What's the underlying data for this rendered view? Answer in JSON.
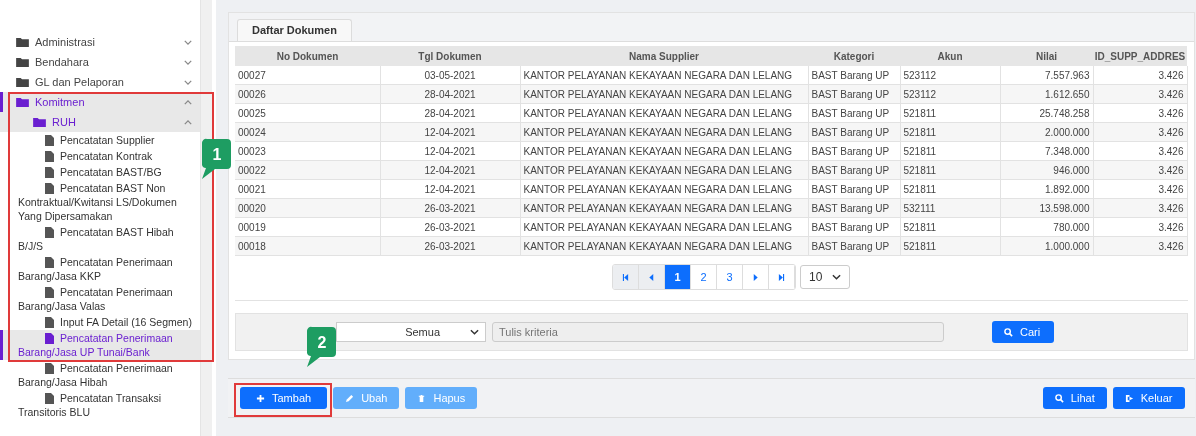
{
  "sidebar": {
    "items": [
      {
        "label": "Administrasi",
        "expanded": false,
        "active": false
      },
      {
        "label": "Bendahara",
        "expanded": false,
        "active": false
      },
      {
        "label": "GL dan Pelaporan",
        "expanded": false,
        "active": false
      },
      {
        "label": "Komitmen",
        "expanded": true,
        "active": true,
        "children": [
          {
            "label": "RUH",
            "expanded": true,
            "active": true,
            "children": [
              {
                "label": "Pencatatan Supplier",
                "selected": false
              },
              {
                "label": "Pencatatan Kontrak",
                "selected": false
              },
              {
                "label": "Pencatatan BAST/BG",
                "selected": false
              },
              {
                "label": "Pencatatan BAST Non Kontraktual/Kwitansi LS/Dokumen Yang Dipersamakan",
                "selected": false
              },
              {
                "label": "Pencatatan BAST Hibah B/J/S",
                "selected": false
              },
              {
                "label": "Pencatatan Penerimaan Barang/Jasa KKP",
                "selected": false
              },
              {
                "label": "Pencatatan Penerimaan Barang/Jasa Valas",
                "selected": false
              },
              {
                "label": "Input FA Detail (16 Segmen)",
                "selected": false
              },
              {
                "label": "Pencatatan Penerimaan Barang/Jasa UP Tunai/Bank",
                "selected": true
              },
              {
                "label": "Pencatatan Penerimaan Barang/Jasa Hibah",
                "selected": false
              },
              {
                "label": "Pencatatan Transaksi Transitoris BLU",
                "selected": false
              }
            ]
          }
        ]
      }
    ]
  },
  "panel": {
    "tab": "Daftar Dokumen",
    "table": {
      "columns": [
        "No Dokumen",
        "Tgl Dokumen",
        "Nama Supplier",
        "Kategori",
        "Akun",
        "Nilai",
        "ID_SUPP_ADDRES"
      ],
      "rows": [
        [
          "00027",
          "03-05-2021",
          "KANTOR PELAYANAN KEKAYAAN NEGARA DAN LELANG",
          "BAST Barang UP",
          "523112",
          "7.557.963",
          "3.426"
        ],
        [
          "00026",
          "28-04-2021",
          "KANTOR PELAYANAN KEKAYAAN NEGARA DAN LELANG",
          "BAST Barang UP",
          "523112",
          "1.612.650",
          "3.426"
        ],
        [
          "00025",
          "28-04-2021",
          "KANTOR PELAYANAN KEKAYAAN NEGARA DAN LELANG",
          "BAST Barang UP",
          "521811",
          "25.748.258",
          "3.426"
        ],
        [
          "00024",
          "12-04-2021",
          "KANTOR PELAYANAN KEKAYAAN NEGARA DAN LELANG",
          "BAST Barang UP",
          "521811",
          "2.000.000",
          "3.426"
        ],
        [
          "00023",
          "12-04-2021",
          "KANTOR PELAYANAN KEKAYAAN NEGARA DAN LELANG",
          "BAST Barang UP",
          "521811",
          "7.348.000",
          "3.426"
        ],
        [
          "00022",
          "12-04-2021",
          "KANTOR PELAYANAN KEKAYAAN NEGARA DAN LELANG",
          "BAST Barang UP",
          "521811",
          "946.000",
          "3.426"
        ],
        [
          "00021",
          "12-04-2021",
          "KANTOR PELAYANAN KEKAYAAN NEGARA DAN LELANG",
          "BAST Barang UP",
          "521811",
          "1.892.000",
          "3.426"
        ],
        [
          "00020",
          "26-03-2021",
          "KANTOR PELAYANAN KEKAYAAN NEGARA DAN LELANG",
          "BAST Barang UP",
          "532111",
          "13.598.000",
          "3.426"
        ],
        [
          "00019",
          "26-03-2021",
          "KANTOR PELAYANAN KEKAYAAN NEGARA DAN LELANG",
          "BAST Barang UP",
          "521811",
          "780.000",
          "3.426"
        ],
        [
          "00018",
          "26-03-2021",
          "KANTOR PELAYANAN KEKAYAAN NEGARA DAN LELANG",
          "BAST Barang UP",
          "521811",
          "1.000.000",
          "3.426"
        ]
      ]
    },
    "pager": {
      "items": [
        {
          "kind": "first",
          "disabled": true
        },
        {
          "kind": "prev",
          "disabled": true
        },
        {
          "kind": "page",
          "label": "1",
          "selected": true
        },
        {
          "kind": "page",
          "label": "2",
          "selected": false
        },
        {
          "kind": "page",
          "label": "3",
          "selected": false
        },
        {
          "kind": "next",
          "disabled": false
        },
        {
          "kind": "last",
          "disabled": false
        }
      ],
      "page_size": "10"
    },
    "search": {
      "filter": "Semua",
      "placeholder": "Tulis kriteria",
      "button": "Cari"
    }
  },
  "toolbar": {
    "left": [
      {
        "kind": "add",
        "label": "Tambah",
        "disabled": false
      },
      {
        "kind": "edit",
        "label": "Ubah",
        "disabled": true
      },
      {
        "kind": "delete",
        "label": "Hapus",
        "disabled": true
      }
    ],
    "right": [
      {
        "kind": "view",
        "label": "Lihat",
        "disabled": false
      },
      {
        "kind": "exit",
        "label": "Keluar",
        "disabled": false
      }
    ]
  },
  "callouts": [
    {
      "label": "1"
    },
    {
      "label": "2"
    }
  ]
}
